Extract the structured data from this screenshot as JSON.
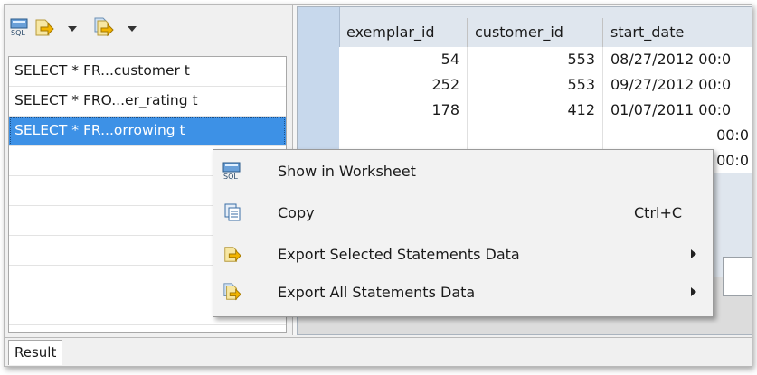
{
  "toolbar": {
    "show_worksheet_icon": "sql-worksheet-icon",
    "export_selected_icon": "export-selected-icon",
    "export_all_icon": "export-all-icon"
  },
  "statements": [
    {
      "label": "SELECT * FR...customer t"
    },
    {
      "label": "SELECT * FRO...er_rating t"
    },
    {
      "label": "SELECT * FR...orrowing t"
    }
  ],
  "tabs": {
    "result": "Result"
  },
  "grid": {
    "columns": [
      "exemplar_id",
      "customer_id",
      "start_date"
    ],
    "rows": [
      {
        "exemplar_id": "54",
        "customer_id": "553",
        "start_date": "08/27/2012 00:0"
      },
      {
        "exemplar_id": "252",
        "customer_id": "553",
        "start_date": "09/27/2012 00:0"
      },
      {
        "exemplar_id": "178",
        "customer_id": "412",
        "start_date": "01/07/2011 00:0"
      },
      {
        "exemplar_id": "",
        "customer_id": "",
        "start_date": "00:0"
      },
      {
        "exemplar_id": "",
        "customer_id": "",
        "start_date": "00:0"
      }
    ]
  },
  "context_menu": {
    "show_in_worksheet": "Show in Worksheet",
    "copy": "Copy",
    "copy_shortcut": "Ctrl+C",
    "export_selected": "Export Selected Statements Data",
    "export_all": "Export All Statements Data"
  },
  "colors": {
    "selection": "#3d91e6",
    "row_header": "#c7d8ec",
    "menu_bg": "#f2f2f2"
  }
}
